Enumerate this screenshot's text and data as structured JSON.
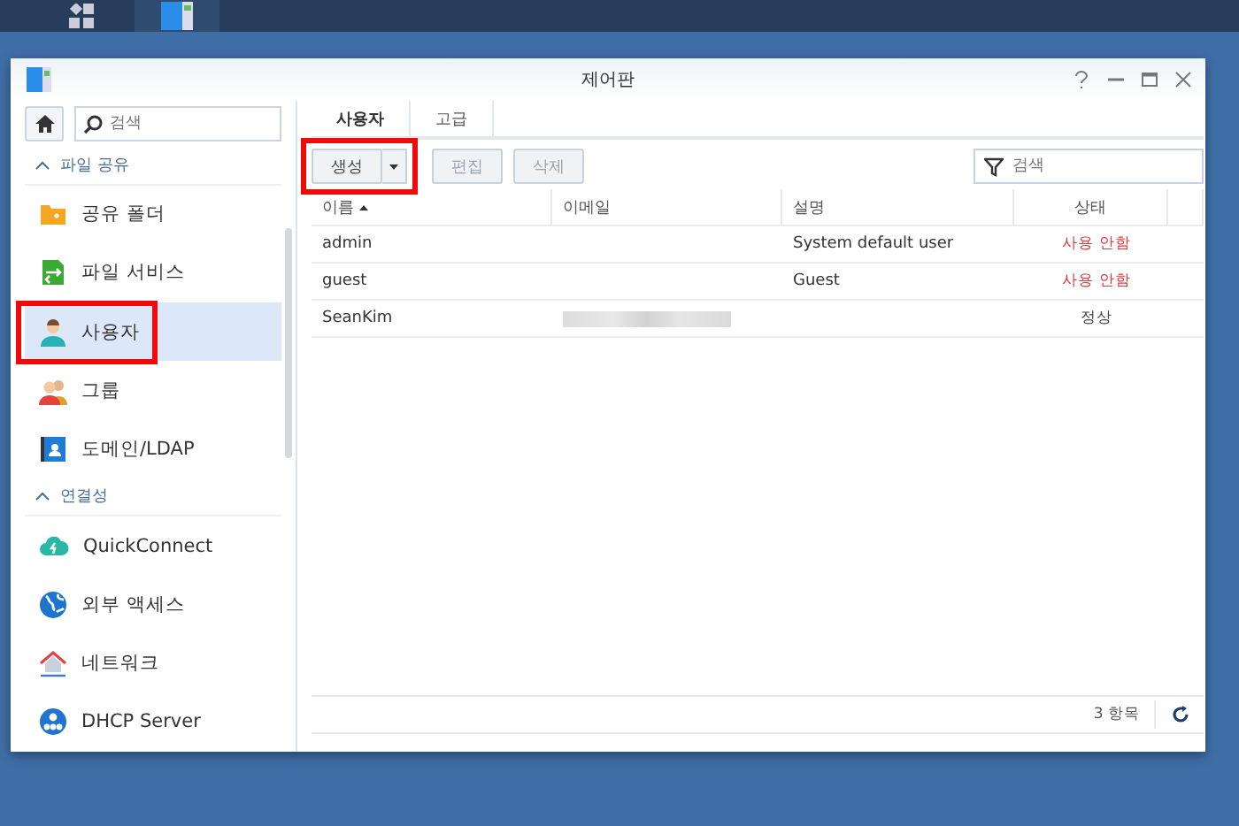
{
  "window": {
    "title": "제어판"
  },
  "sidebar": {
    "search": {
      "placeholder": "검색"
    },
    "sections": [
      {
        "title": "파일 공유",
        "expanded": true,
        "items": [
          {
            "label": "공유 폴더",
            "kind": "folder",
            "selected": false,
            "highlighted": false
          },
          {
            "label": "파일 서비스",
            "kind": "fileservice",
            "selected": false,
            "highlighted": false
          },
          {
            "label": "사용자",
            "kind": "user",
            "selected": true,
            "highlighted": true
          },
          {
            "label": "그룹",
            "kind": "group",
            "selected": false,
            "highlighted": false
          },
          {
            "label": "도메인/LDAP",
            "kind": "domain",
            "selected": false,
            "highlighted": false
          }
        ]
      },
      {
        "title": "연결성",
        "expanded": true,
        "items": [
          {
            "label": "QuickConnect",
            "kind": "cloud",
            "selected": false,
            "highlighted": false
          },
          {
            "label": "외부 액세스",
            "kind": "globe",
            "selected": false,
            "highlighted": false
          },
          {
            "label": "네트워크",
            "kind": "house",
            "selected": false,
            "highlighted": false
          },
          {
            "label": "DHCP Server",
            "kind": "dhcp",
            "selected": false,
            "highlighted": false
          }
        ]
      }
    ]
  },
  "tabs": [
    {
      "label": "사용자",
      "selected": true
    },
    {
      "label": "고급",
      "selected": false
    }
  ],
  "toolbar": {
    "create": {
      "label": "생성",
      "highlighted": true
    },
    "buttons": [
      {
        "label": "편집",
        "disabled": true
      },
      {
        "label": "삭제",
        "disabled": true
      }
    ],
    "filter": {
      "placeholder": "검색"
    }
  },
  "table": {
    "columns": [
      {
        "label": "이름",
        "sorted": true
      },
      {
        "label": "이메일",
        "sorted": false
      },
      {
        "label": "설명",
        "sorted": false
      },
      {
        "label": "상태",
        "sorted": false
      }
    ],
    "rows": [
      {
        "name": "admin",
        "email_blurred": false,
        "description": "System default user",
        "status": "사용 안함",
        "color": "#e03b3b"
      },
      {
        "name": "guest",
        "email_blurred": false,
        "description": "Guest",
        "status": "사용 안함",
        "color": "#e03b3b"
      },
      {
        "name": "SeanKim",
        "email_blurred": true,
        "status": "정상",
        "color": "#444444"
      }
    ]
  },
  "footer": {
    "count": "3 항목"
  }
}
